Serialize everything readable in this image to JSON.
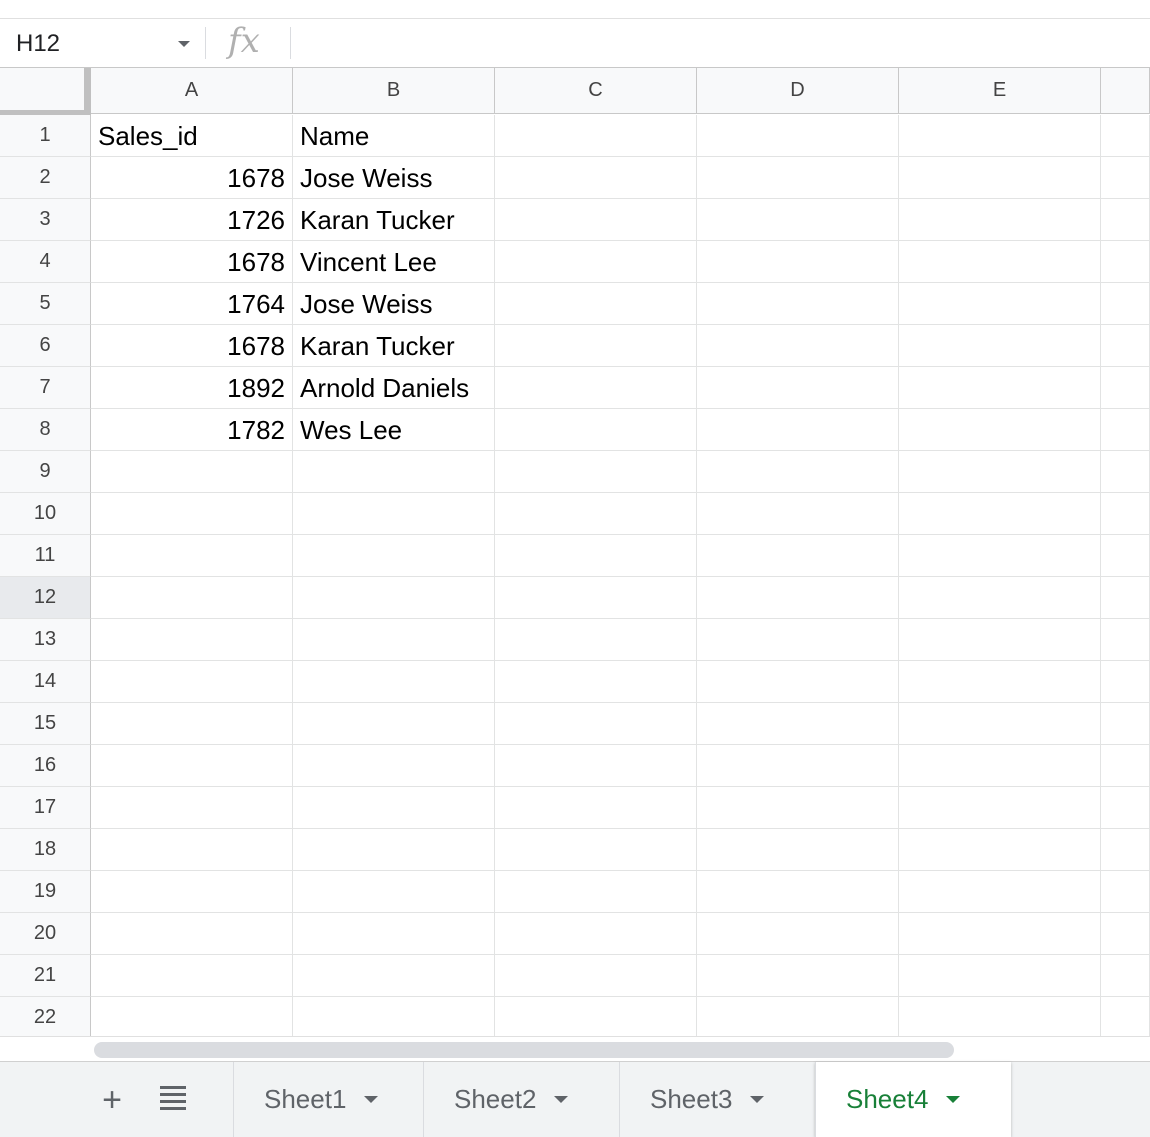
{
  "formula_bar": {
    "name_box": "H12",
    "fx_label": "fx",
    "formula": ""
  },
  "columns": [
    "A",
    "B",
    "C",
    "D",
    "E"
  ],
  "rows": [
    "1",
    "2",
    "3",
    "4",
    "5",
    "6",
    "7",
    "8",
    "9",
    "10",
    "11",
    "12",
    "13",
    "14",
    "15",
    "16",
    "17",
    "18",
    "19",
    "20",
    "21",
    "22"
  ],
  "selected_row": "12",
  "cells": {
    "header": [
      "Sales_id",
      "Name"
    ],
    "data": [
      [
        "1678",
        "Jose Weiss"
      ],
      [
        "1726",
        "Karan Tucker"
      ],
      [
        "1678",
        "Vincent Lee"
      ],
      [
        "1764",
        "Jose Weiss"
      ],
      [
        "1678",
        "Karan Tucker"
      ],
      [
        "1892",
        "Arnold Daniels"
      ],
      [
        "1782",
        "Wes Lee"
      ]
    ]
  },
  "sheets": {
    "add_icon": "+",
    "tabs": [
      "Sheet1",
      "Sheet2",
      "Sheet3",
      "Sheet4"
    ],
    "active": "Sheet4"
  },
  "colors": {
    "active_tab": "#188038",
    "header_bg": "#f8f9fa",
    "gridline": "#e2e3e3"
  }
}
